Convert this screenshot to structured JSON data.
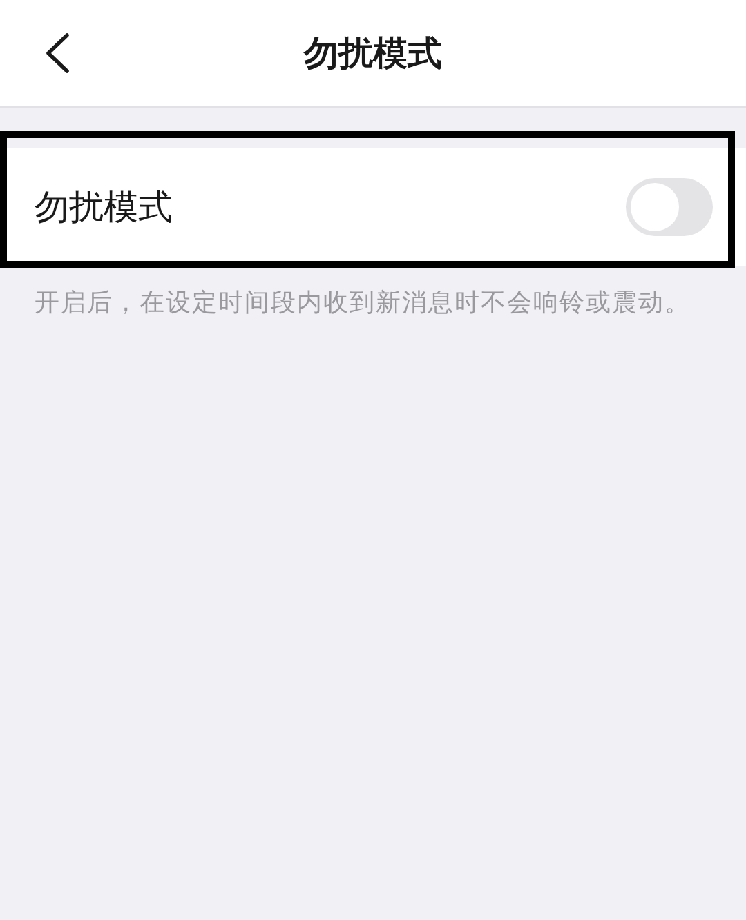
{
  "header": {
    "title": "勿扰模式"
  },
  "setting": {
    "label": "勿扰模式",
    "on": false,
    "highlighted": true
  },
  "description": "开启后，在设定时间段内收到新消息时不会响铃或震动。"
}
